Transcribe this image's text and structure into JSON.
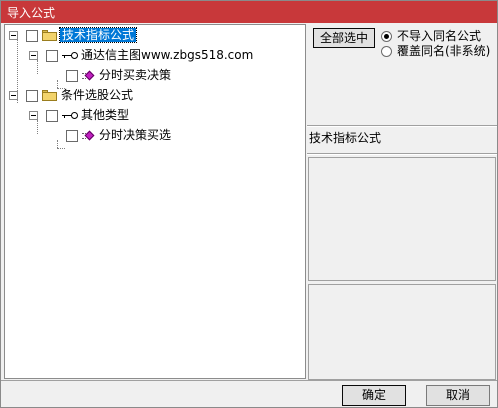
{
  "window": {
    "title": "导入公式",
    "accent_color": "#c8383a"
  },
  "tree": {
    "nodes": [
      {
        "label": "技术指标公式",
        "icon": "folder-icon",
        "selected": true
      },
      {
        "label": "通达信主图www.zbgs518.com",
        "icon": "key-icon"
      },
      {
        "label": "分时买卖决策",
        "icon": "formula-icon"
      },
      {
        "label": "条件选股公式",
        "icon": "folder-icon"
      },
      {
        "label": "其他类型",
        "icon": "key-icon"
      },
      {
        "label": "分时决策买选",
        "icon": "formula-icon"
      }
    ]
  },
  "options": {
    "select_all_label": "全部选中",
    "radio_skip_label": "不导入同名公式",
    "radio_overwrite_label": "覆盖同名(非系统)",
    "selected_radio": "不导入同名公式"
  },
  "info": {
    "section_label": "技术指标公式"
  },
  "footer": {
    "ok_label": "确定",
    "cancel_label": "取消"
  }
}
